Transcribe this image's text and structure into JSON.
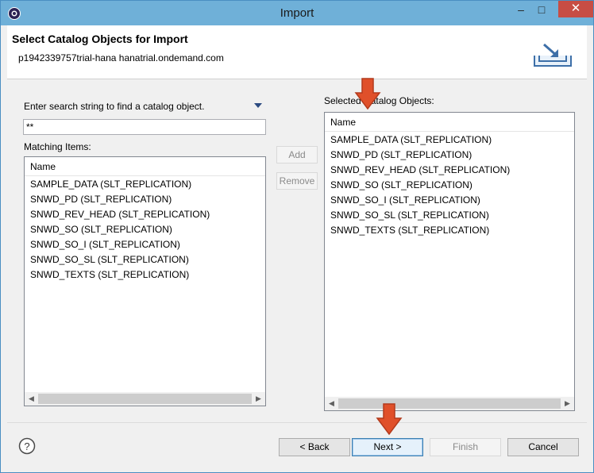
{
  "window": {
    "title": "Import",
    "minimize": "–",
    "maximize": "□",
    "close": "✕"
  },
  "header": {
    "title": "Select Catalog Objects for Import",
    "subtitle": "p1942339757trial-hana hanatrial.ondemand.com"
  },
  "search": {
    "label": "Enter search string to find a catalog object.",
    "value": "**"
  },
  "matching": {
    "label": "Matching Items:",
    "column": "Name",
    "items": [
      "SAMPLE_DATA (SLT_REPLICATION)",
      "SNWD_PD (SLT_REPLICATION)",
      "SNWD_REV_HEAD (SLT_REPLICATION)",
      "SNWD_SO (SLT_REPLICATION)",
      "SNWD_SO_I (SLT_REPLICATION)",
      "SNWD_SO_SL (SLT_REPLICATION)",
      "SNWD_TEXTS (SLT_REPLICATION)"
    ]
  },
  "selected": {
    "label": "Selected Catalog Objects:",
    "column": "Name",
    "items": [
      "SAMPLE_DATA (SLT_REPLICATION)",
      "SNWD_PD (SLT_REPLICATION)",
      "SNWD_REV_HEAD (SLT_REPLICATION)",
      "SNWD_SO (SLT_REPLICATION)",
      "SNWD_SO_I (SLT_REPLICATION)",
      "SNWD_SO_SL (SLT_REPLICATION)",
      "SNWD_TEXTS (SLT_REPLICATION)"
    ]
  },
  "actions": {
    "add": "Add",
    "remove": "Remove"
  },
  "footer": {
    "help": "?",
    "back": "< Back",
    "next": "Next >",
    "finish": "Finish",
    "cancel": "Cancel"
  },
  "colors": {
    "titlebar": "#6fb0d8",
    "close": "#c74d44",
    "annotation_arrow": "#e0502a"
  },
  "icons": {
    "app": "eclipse-gear-icon",
    "header": "import-tray-icon",
    "search_menu": "dropdown-triangle-icon",
    "help": "question-circle-icon",
    "annotation": "red-down-arrow-icon"
  }
}
